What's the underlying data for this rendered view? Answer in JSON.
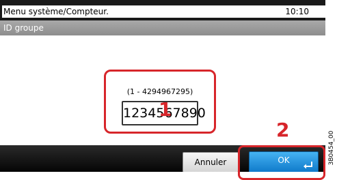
{
  "status_bar": {
    "title": "Menu système/Compteur.",
    "clock": "10:10"
  },
  "header": {
    "title": "ID groupe"
  },
  "input": {
    "range_label": "(1 - 4294967295)",
    "value": "1234567890"
  },
  "callouts": {
    "one": "1",
    "two": "2"
  },
  "footer": {
    "cancel_label": "Annuler",
    "ok_label": "OK"
  },
  "figure_code": "3B0454_00",
  "colors": {
    "callout": "#d7252a",
    "ok_button": "#1a8fdf",
    "title_bar": "#1a1a1a",
    "header_bar": "#9a9a9a"
  },
  "icons": {
    "enter": "enter-return-icon"
  }
}
